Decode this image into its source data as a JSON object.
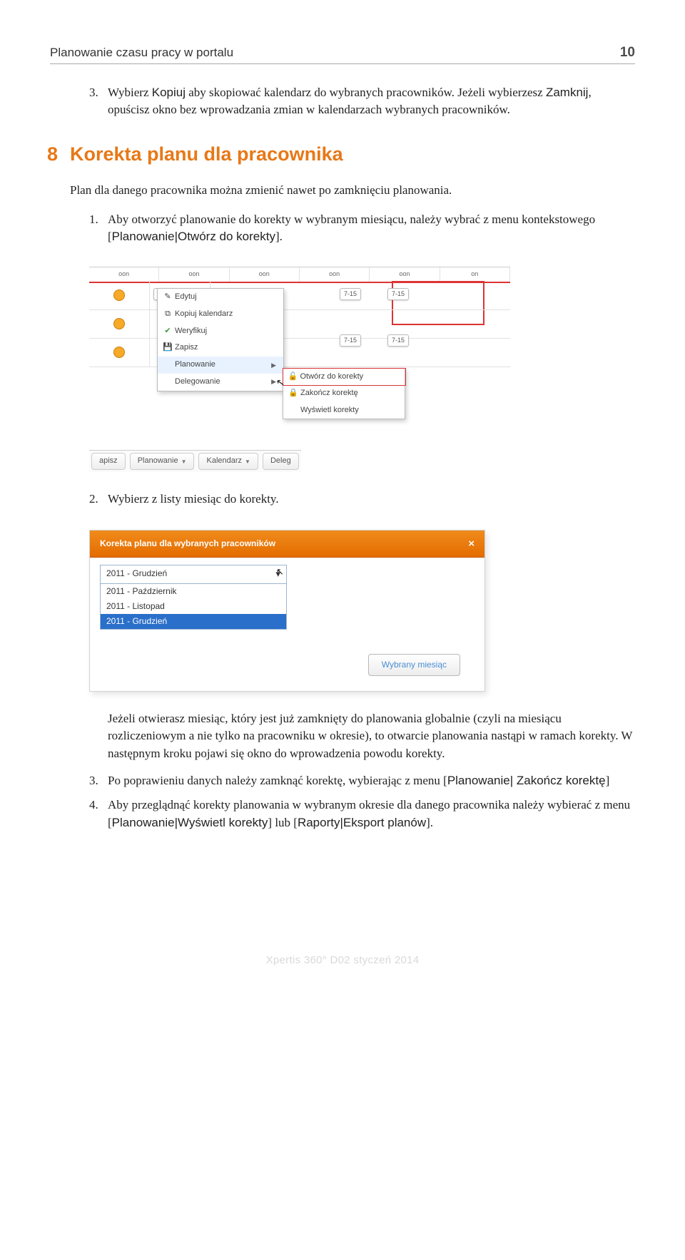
{
  "header": {
    "title": "Planowanie czasu pracy w portalu",
    "page": "10"
  },
  "sec3": {
    "n": "3.",
    "t_a": "Wybierz ",
    "kopiuj": "Kopiuj",
    "t_b": " aby skopiować kalendarz do wybranych pracowników. Jeżeli wybierzesz ",
    "zamknij": "Zamknij",
    "t_c": ", opuścisz okno bez wprowadzania zmian w kalendarzach wybranych pracowników."
  },
  "section8": {
    "num": "8",
    "title": "Korekta planu dla pracownika"
  },
  "intro": "Plan dla danego pracownika można zmienić nawet po zamknięciu planowania.",
  "step1": {
    "n": "1.",
    "t_a": "Aby otworzyć planowanie do korekty w wybranym miesiącu, należy wybrać z menu kontekstowego [",
    "m": "Planowanie|Otwórz do korekty",
    "t_b": "]."
  },
  "shot1": {
    "hcells": [
      "oon",
      "oon",
      "oon",
      "oon",
      "oon",
      "on"
    ],
    "tag": "7-15",
    "menu": {
      "edytuj": "Edytuj",
      "kopiuj": "Kopiuj kalendarz",
      "weryfikuj": "Weryfikuj",
      "zapisz": "Zapisz",
      "planowanie": "Planowanie",
      "delegowanie": "Delegowanie"
    },
    "submenu": {
      "otworz": "Otwórz do korekty",
      "zakoncz": "Zakończ korektę",
      "wyswietl": "Wyświetl korekty"
    },
    "toolbar": {
      "apisz": "apisz",
      "planowanie": "Planowanie",
      "kalendarz": "Kalendarz",
      "deleg": "Deleg"
    }
  },
  "step2": {
    "n": "2.",
    "t": "Wybierz z listy miesiąc do korekty."
  },
  "shot2": {
    "title": "Korekta planu dla wybranych pracowników",
    "close": "×",
    "selected": "2011 - Grudzień",
    "options": [
      "2011 - Październik",
      "2011 - Listopad",
      "2011 - Grudzień"
    ],
    "button": "Wybrany miesiąc"
  },
  "para_after": "Jeżeli otwierasz miesiąc, który jest już zamknięty do planowania globalnie (czyli na miesiącu rozliczeniowym a nie tylko na pracowniku w okresie), to otwarcie planowania nastąpi w ramach korekty. W następnym kroku pojawi się okno do wprowadzenia powodu korekty.",
  "step3": {
    "n": "3.",
    "t_a": "Po poprawieniu danych należy zamknąć korektę, wybierając z menu [",
    "m": "Planowanie| Zakończ korektę",
    "t_b": "]"
  },
  "step4": {
    "n": "4.",
    "t_a": "Aby przeglądnąć korekty planowania w wybranym okresie dla danego pracownika należy wybierać z menu [",
    "m1": "Planowanie|Wyświetl korekty",
    "t_b": "] lub [",
    "m2": "Raporty|Eksport planów",
    "t_c": "]."
  },
  "footer": "Xpertis 360° D02   styczeń 2014"
}
